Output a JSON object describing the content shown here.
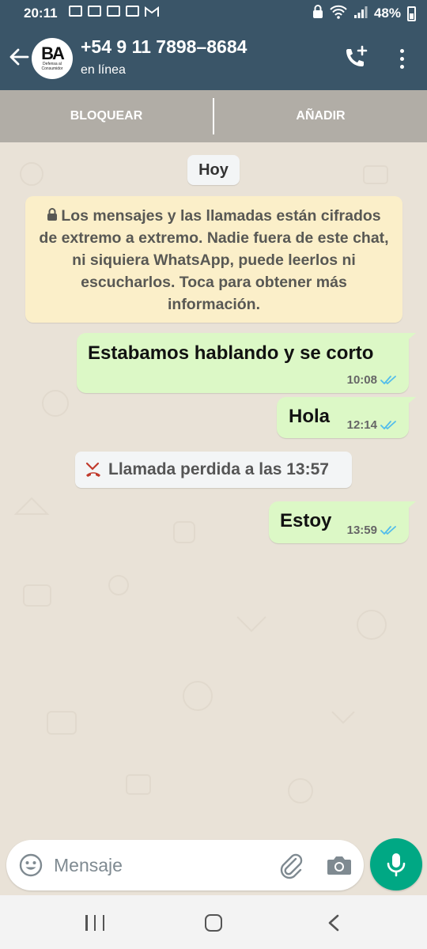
{
  "status_bar": {
    "time": "20:11",
    "notification_icons": [
      "mail-icon",
      "mail-icon",
      "mail-icon",
      "image-icon",
      "gmail-icon"
    ],
    "battery": "48%"
  },
  "header": {
    "contact_name": "+54 9 11 7898–8684",
    "status": "en línea",
    "avatar": {
      "mark": "BA",
      "caption": "Defensa al Consumidor"
    }
  },
  "action_bar": {
    "block_label": "BLOQUEAR",
    "add_label": "AÑADIR"
  },
  "chat": {
    "date_chip": "Hoy",
    "encryption_notice": "Los mensajes y las llamadas están cifrados de extremo a extremo. Nadie fuera de este chat, ni siquiera WhatsApp, puede leerlos ni escucharlos. Toca para obtener más información.",
    "messages": [
      {
        "text": "Estabamos hablando y se corto",
        "time": "10:08",
        "status": "read"
      },
      {
        "text": "Hola",
        "time": "12:14",
        "status": "read"
      },
      {
        "text": "Estoy",
        "time": "13:59",
        "status": "read"
      }
    ],
    "missed_call": "Llamada perdida a las 13:57"
  },
  "input": {
    "placeholder": "Mensaje"
  },
  "colors": {
    "header": "#3a5568",
    "chat_bg": "#e9e2d7",
    "outgoing_bubble": "#dcf8c6",
    "notice_bg": "#fbefc9",
    "mic_button": "#00a884",
    "read_ticks": "#53bdeb",
    "missed_call_icon": "#c0392b"
  }
}
